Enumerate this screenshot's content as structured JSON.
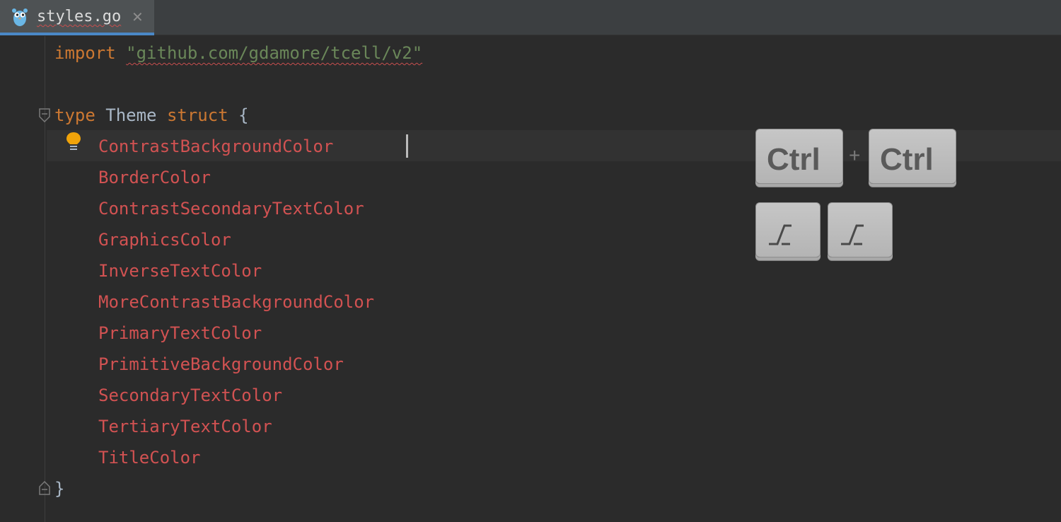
{
  "tab": {
    "filename": "styles.go",
    "close_glyph": "✕",
    "file_icon": "go-gopher-icon"
  },
  "code": {
    "import_keyword": "import",
    "import_path": "\"github.com/gdamore/tcell/v2\"",
    "type_keyword": "type",
    "type_name": "Theme",
    "struct_keyword": "struct",
    "open_brace": "{",
    "close_brace": "}",
    "fields": [
      "ContrastBackgroundColor",
      "BorderColor",
      "ContrastSecondaryTextColor",
      "GraphicsColor",
      "InverseTextColor",
      "MoreContrastBackgroundColor",
      "PrimaryTextColor",
      "PrimitiveBackgroundColor",
      "SecondaryTextColor",
      "TertiaryTextColor",
      "TitleColor"
    ]
  },
  "shortcut_overlay": {
    "key1": "Ctrl",
    "plus": "+",
    "key2": "Ctrl",
    "bottom_keys_icon": "key-press-icon"
  },
  "colors": {
    "editor_bg": "#2b2b2b",
    "keyword": "#cc7832",
    "string": "#6a8759",
    "field_error": "#d25252",
    "tab_accent": "#4a88c7",
    "bulb": "#f0a30a"
  }
}
